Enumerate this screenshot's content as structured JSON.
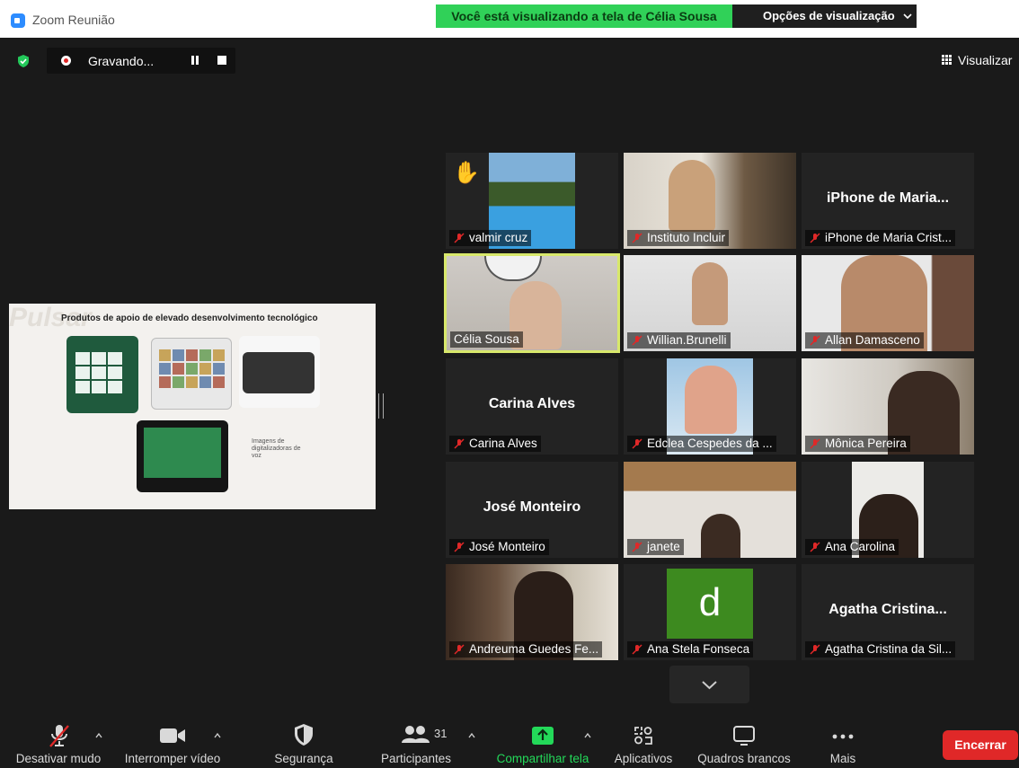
{
  "window": {
    "title": "Zoom Reunião"
  },
  "banner": {
    "viewing": "Você está visualizando a tela de Célia Sousa",
    "view_options": "Opções de visualização"
  },
  "recording": {
    "label": "Gravando..."
  },
  "view_button": {
    "label": "Visualizar"
  },
  "shared_slide": {
    "title": "Produtos de apoio de elevado desenvolvimento tecnológico",
    "note": "Imagens de digitalizadoras de voz",
    "watermark": "Pulsar"
  },
  "participants": [
    {
      "name": "valmir cruz",
      "muted": true,
      "hand_raised": true,
      "video": true
    },
    {
      "name": "Instituto Incluir",
      "muted": true,
      "video": true
    },
    {
      "name": "iPhone de Maria Crist...",
      "display_name": "iPhone de Maria...",
      "muted": true,
      "video": false
    },
    {
      "name": "Célia Sousa",
      "muted": false,
      "video": true,
      "active_speaker": true
    },
    {
      "name": "Willian.Brunelli",
      "muted": true,
      "video": true
    },
    {
      "name": "Allan Damasceno",
      "muted": true,
      "video": true
    },
    {
      "name": "Carina Alves",
      "display_name": "Carina Alves",
      "muted": true,
      "video": false
    },
    {
      "name": "Edclea Cespedes da ...",
      "muted": true,
      "video": true
    },
    {
      "name": "Mônica Pereira",
      "muted": true,
      "video": true
    },
    {
      "name": "José Monteiro",
      "display_name": "José Monteiro",
      "muted": true,
      "video": false
    },
    {
      "name": "janete",
      "muted": true,
      "video": true
    },
    {
      "name": "Ana Carolina",
      "muted": true,
      "video": true
    },
    {
      "name": "Andreuma Guedes Fe...",
      "muted": true,
      "video": true
    },
    {
      "name": "Ana Stela Fonseca",
      "muted": true,
      "video": false,
      "avatar_letter": "d"
    },
    {
      "name": "Agatha Cristina da Sil...",
      "display_name": "Agatha Cristina...",
      "muted": true,
      "video": false
    }
  ],
  "toolbar": {
    "mute": "Desativar mudo",
    "video": "Interromper vídeo",
    "security": "Segurança",
    "participants": "Participantes",
    "participant_count": "31",
    "share": "Compartilhar tela",
    "apps": "Aplicativos",
    "whiteboards": "Quadros brancos",
    "more": "Mais",
    "end": "Encerrar"
  },
  "colors": {
    "accent_green": "#30d158",
    "end_red": "#e02828",
    "share_green": "#23d959",
    "active_border": "#d8e86b",
    "zoom_blue": "#2d8cff"
  }
}
